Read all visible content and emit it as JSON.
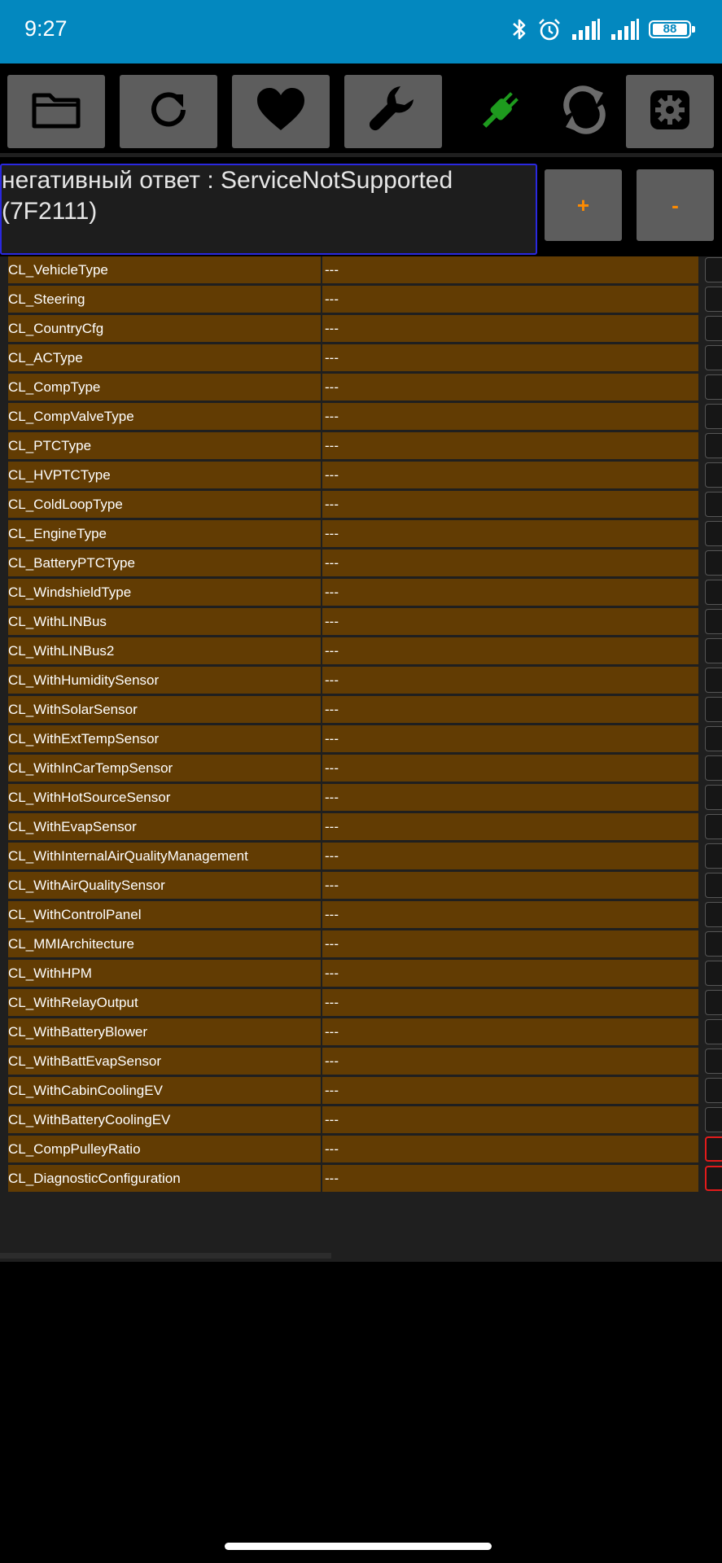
{
  "status_bar": {
    "time": "9:27",
    "battery": "88",
    "icons": [
      "bluetooth-icon",
      "alarm-icon",
      "signal-icon",
      "signal-icon"
    ]
  },
  "toolbar": {
    "buttons": [
      "folder-icon",
      "refresh-icon",
      "heart-icon",
      "wrench-icon",
      "plug-icon",
      "sync-icon",
      "settings-icon"
    ],
    "plug_color": "#1e9a1e"
  },
  "message": {
    "text": "негативный ответ : ServiceNotSupported (7F2111)",
    "plus_label": "+",
    "minus_label": "-"
  },
  "colors": {
    "status_bar": "#0388bf",
    "row": "#623c03",
    "message_border": "#2a28e0",
    "button": "#5d5d5d",
    "accent": "#ff8b00",
    "error_border": "#e21b1b"
  },
  "rows": [
    {
      "name": "CL_VehicleType",
      "value": "---"
    },
    {
      "name": "CL_Steering",
      "value": "---"
    },
    {
      "name": "CL_CountryCfg",
      "value": "---"
    },
    {
      "name": "CL_ACType",
      "value": "---"
    },
    {
      "name": "CL_CompType",
      "value": "---"
    },
    {
      "name": "CL_CompValveType",
      "value": "---"
    },
    {
      "name": "CL_PTCType",
      "value": "---"
    },
    {
      "name": "CL_HVPTCType",
      "value": "---"
    },
    {
      "name": "CL_ColdLoopType",
      "value": "---"
    },
    {
      "name": "CL_EngineType",
      "value": "---"
    },
    {
      "name": "CL_BatteryPTCType",
      "value": "---"
    },
    {
      "name": "CL_WindshieldType",
      "value": "---"
    },
    {
      "name": "CL_WithLINBus",
      "value": "---"
    },
    {
      "name": "CL_WithLINBus2",
      "value": "---"
    },
    {
      "name": "CL_WithHumiditySensor",
      "value": "---"
    },
    {
      "name": "CL_WithSolarSensor",
      "value": "---"
    },
    {
      "name": "CL_WithExtTempSensor",
      "value": "---"
    },
    {
      "name": "CL_WithInCarTempSensor",
      "value": "---"
    },
    {
      "name": "CL_WithHotSourceSensor",
      "value": "---"
    },
    {
      "name": "CL_WithEvapSensor",
      "value": "---"
    },
    {
      "name": "CL_WithInternalAirQualityManagement",
      "value": "---"
    },
    {
      "name": "CL_WithAirQualitySensor",
      "value": "---"
    },
    {
      "name": "CL_WithControlPanel",
      "value": "---"
    },
    {
      "name": "CL_MMIArchitecture",
      "value": "---"
    },
    {
      "name": "CL_WithHPM",
      "value": "---"
    },
    {
      "name": "CL_WithRelayOutput",
      "value": "---"
    },
    {
      "name": "CL_WithBatteryBlower",
      "value": "---"
    },
    {
      "name": "CL_WithBattEvapSensor",
      "value": "---"
    },
    {
      "name": "CL_WithCabinCoolingEV",
      "value": "---"
    },
    {
      "name": "CL_WithBatteryCoolingEV",
      "value": "---"
    },
    {
      "name": "CL_CompPulleyRatio",
      "value": "---",
      "error": true
    },
    {
      "name": "CL_DiagnosticConfiguration",
      "value": "---",
      "error": true
    }
  ]
}
